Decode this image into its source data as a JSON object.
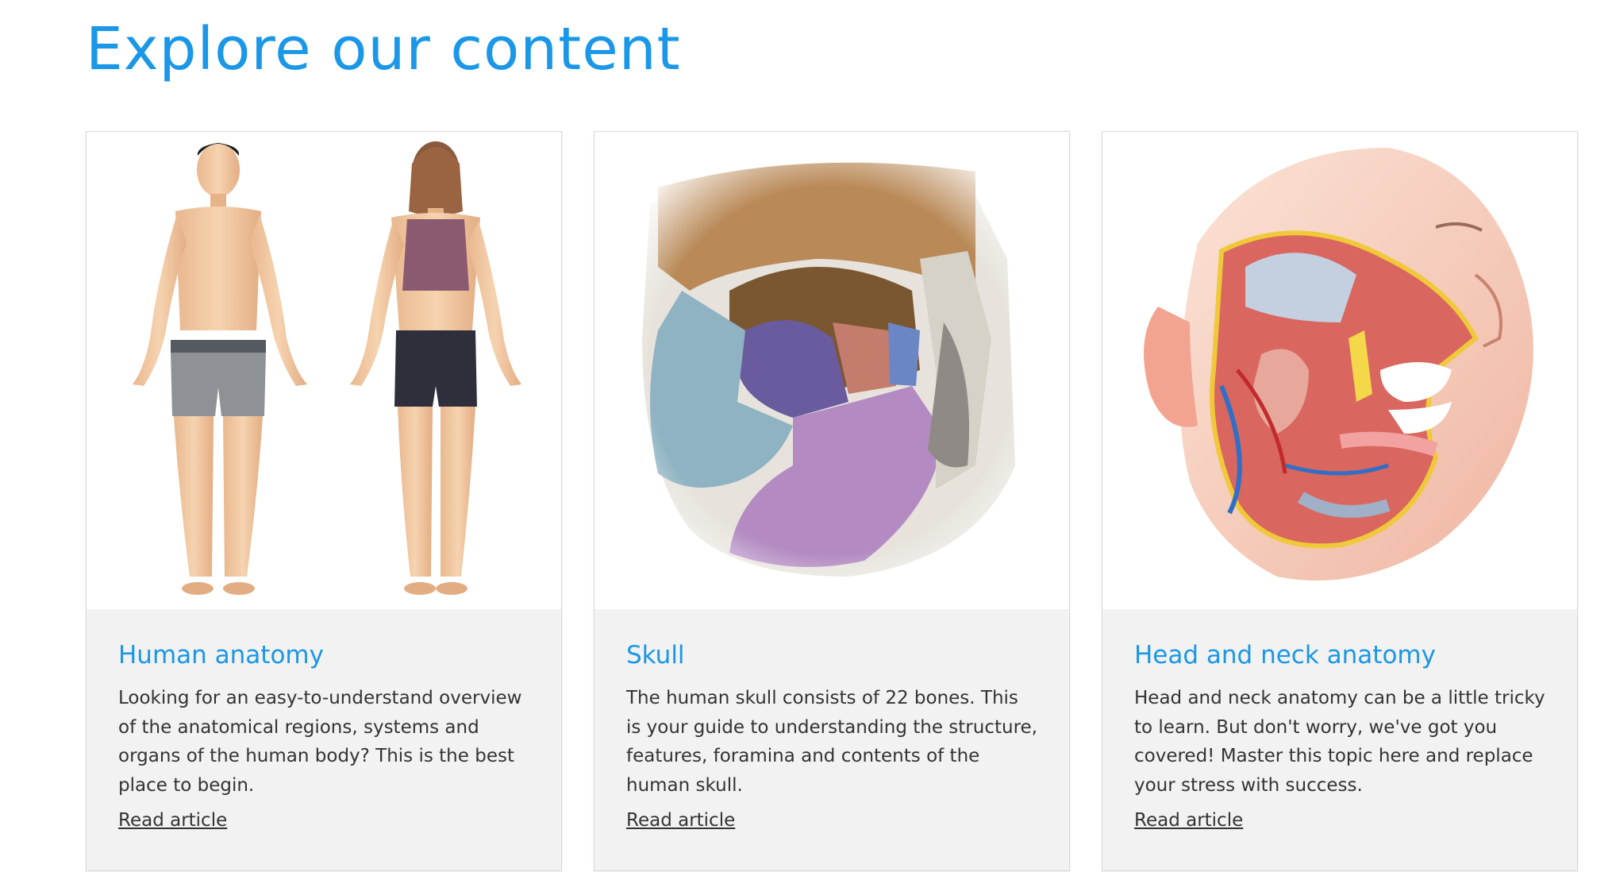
{
  "page": {
    "title": "Explore our content"
  },
  "cards": [
    {
      "title": "Human anatomy",
      "description": "Looking for an easy-to-understand overview of the anatomical regions, systems and organs of the human body? This is the best place to begin.",
      "link_label": "Read article",
      "image": "human-anatomy-illustration"
    },
    {
      "title": "Skull",
      "description": "The human skull consists of 22 bones. This is your guide to understanding the structure, features, foramina and contents of the human skull.",
      "link_label": "Read article",
      "image": "skull-illustration"
    },
    {
      "title": "Head and neck anatomy",
      "description": "Head and neck anatomy can be a little tricky to learn. But don't worry, we've got you covered! Master this topic here and replace your stress with success.",
      "link_label": "Read article",
      "image": "head-and-neck-illustration"
    }
  ],
  "colors": {
    "accent": "#1a97e6",
    "text": "#333333",
    "card_body_bg": "#f2f2f2",
    "card_border": "#d9d9d9"
  }
}
